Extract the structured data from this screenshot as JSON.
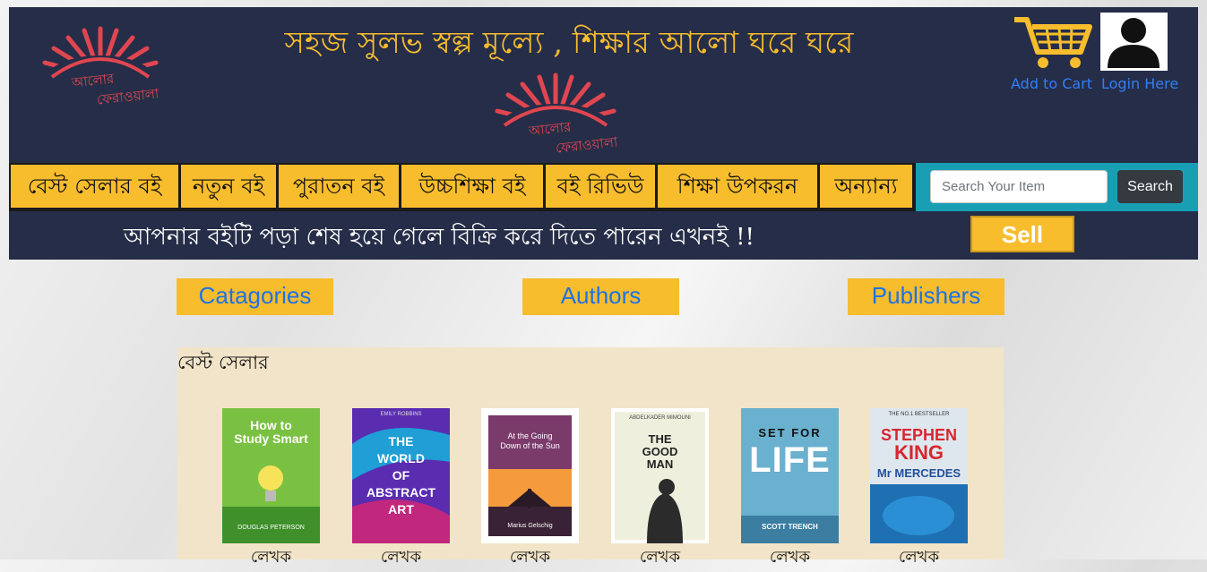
{
  "header": {
    "tagline": "সহজ সুলভ স্বল্প মূল্যে , শিক্ষার আলো ঘরে ঘরে",
    "logo_text_line1": "আলোর",
    "logo_text_line2": "ফেরাওয়ালা",
    "cart_link": "Add to Cart",
    "login_link": "Login Here"
  },
  "nav": {
    "items": [
      {
        "label": "বেস্ট সেলার বই"
      },
      {
        "label": "নতুন বই"
      },
      {
        "label": "পুরাতন বই"
      },
      {
        "label": "উচ্চশিক্ষা বই"
      },
      {
        "label": "বই রিভিউ"
      },
      {
        "label": "শিক্ষা উপকরন"
      },
      {
        "label": "অন্যান্য"
      }
    ],
    "search_placeholder": "Search Your Item",
    "search_button": "Search"
  },
  "sell": {
    "message": "আপনার বইটি পড়া শেষ হয়ে গেলে বিক্রি করে দিতে পারেন এখনই !!",
    "button": "Sell"
  },
  "tabs": [
    "Catagories",
    "Authors",
    "Publishers"
  ],
  "bestseller": {
    "title": "বেস্ট সেলার",
    "books": [
      {
        "label": "লেখক",
        "cover_lines": [
          "How to",
          "Study Smart"
        ],
        "author": "DOUGLAS PETERSON",
        "colors": [
          "#7ac143",
          "#3f8f2a"
        ]
      },
      {
        "label": "লেখক",
        "cover_lines": [
          "THE",
          "WORLD",
          "OF",
          "ABSTRACT",
          "ART"
        ],
        "author": "EMILY ROBBINS",
        "colors": [
          "#5a2db0",
          "#1f9fd6"
        ]
      },
      {
        "label": "লেখক",
        "cover_lines": [
          "At the Going",
          "Down of the Sun"
        ],
        "author": "Marius Gelschig",
        "colors": [
          "#7a3b6b",
          "#f59b3b"
        ]
      },
      {
        "label": "লেখক",
        "cover_lines": [
          "THE",
          "GOOD",
          "MAN"
        ],
        "author": "ABDELKADER MIMOUNI",
        "colors": [
          "#eef0dd",
          "#c7d1a8"
        ]
      },
      {
        "label": "লেখক",
        "cover_lines": [
          "SET FOR",
          "LIFE"
        ],
        "author": "SCOTT TRENCH",
        "colors": [
          "#6ab0cf",
          "#3b7ea1"
        ]
      },
      {
        "label": "লেখক",
        "cover_lines": [
          "STEPHEN",
          "KING",
          "Mr MERCEDES"
        ],
        "author": "THE NO.1 BESTSELLER",
        "colors": [
          "#dfe7ee",
          "#1f6fb3"
        ]
      }
    ]
  }
}
